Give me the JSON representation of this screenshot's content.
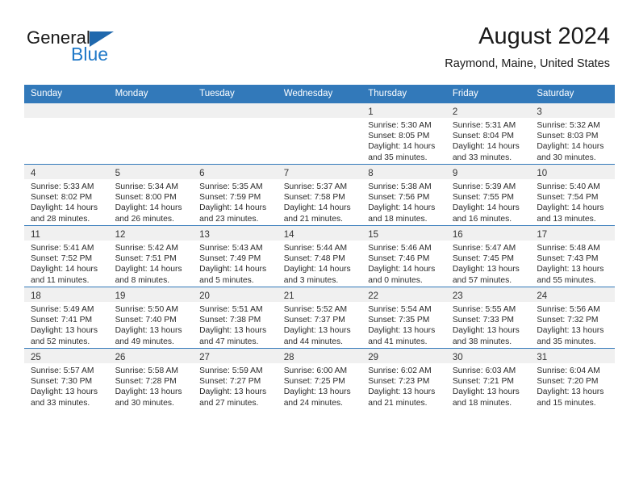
{
  "brand": {
    "line1": "General",
    "line2": "Blue",
    "flag_color": "#1f68ad",
    "text_color": "#2079c8"
  },
  "header": {
    "title": "August 2024",
    "location": "Raymond, Maine, United States"
  },
  "theme": {
    "header_bg": "#3279ba",
    "header_text": "#ffffff",
    "daynum_band_bg": "#f0f0f0",
    "cell_bg": "#ffffff",
    "grid_line": "#3279ba"
  },
  "weekday_headers": [
    "Sunday",
    "Monday",
    "Tuesday",
    "Wednesday",
    "Thursday",
    "Friday",
    "Saturday"
  ],
  "labels": {
    "sunrise": "Sunrise:",
    "sunset": "Sunset:",
    "daylight": "Daylight:"
  },
  "weeks": [
    [
      {
        "day": "",
        "empty": true
      },
      {
        "day": "",
        "empty": true
      },
      {
        "day": "",
        "empty": true
      },
      {
        "day": "",
        "empty": true
      },
      {
        "day": "1",
        "sunrise": "Sunrise: 5:30 AM",
        "sunset": "Sunset: 8:05 PM",
        "daylight1": "Daylight: 14 hours",
        "daylight2": "and 35 minutes."
      },
      {
        "day": "2",
        "sunrise": "Sunrise: 5:31 AM",
        "sunset": "Sunset: 8:04 PM",
        "daylight1": "Daylight: 14 hours",
        "daylight2": "and 33 minutes."
      },
      {
        "day": "3",
        "sunrise": "Sunrise: 5:32 AM",
        "sunset": "Sunset: 8:03 PM",
        "daylight1": "Daylight: 14 hours",
        "daylight2": "and 30 minutes."
      }
    ],
    [
      {
        "day": "4",
        "sunrise": "Sunrise: 5:33 AM",
        "sunset": "Sunset: 8:02 PM",
        "daylight1": "Daylight: 14 hours",
        "daylight2": "and 28 minutes."
      },
      {
        "day": "5",
        "sunrise": "Sunrise: 5:34 AM",
        "sunset": "Sunset: 8:00 PM",
        "daylight1": "Daylight: 14 hours",
        "daylight2": "and 26 minutes."
      },
      {
        "day": "6",
        "sunrise": "Sunrise: 5:35 AM",
        "sunset": "Sunset: 7:59 PM",
        "daylight1": "Daylight: 14 hours",
        "daylight2": "and 23 minutes."
      },
      {
        "day": "7",
        "sunrise": "Sunrise: 5:37 AM",
        "sunset": "Sunset: 7:58 PM",
        "daylight1": "Daylight: 14 hours",
        "daylight2": "and 21 minutes."
      },
      {
        "day": "8",
        "sunrise": "Sunrise: 5:38 AM",
        "sunset": "Sunset: 7:56 PM",
        "daylight1": "Daylight: 14 hours",
        "daylight2": "and 18 minutes."
      },
      {
        "day": "9",
        "sunrise": "Sunrise: 5:39 AM",
        "sunset": "Sunset: 7:55 PM",
        "daylight1": "Daylight: 14 hours",
        "daylight2": "and 16 minutes."
      },
      {
        "day": "10",
        "sunrise": "Sunrise: 5:40 AM",
        "sunset": "Sunset: 7:54 PM",
        "daylight1": "Daylight: 14 hours",
        "daylight2": "and 13 minutes."
      }
    ],
    [
      {
        "day": "11",
        "sunrise": "Sunrise: 5:41 AM",
        "sunset": "Sunset: 7:52 PM",
        "daylight1": "Daylight: 14 hours",
        "daylight2": "and 11 minutes."
      },
      {
        "day": "12",
        "sunrise": "Sunrise: 5:42 AM",
        "sunset": "Sunset: 7:51 PM",
        "daylight1": "Daylight: 14 hours",
        "daylight2": "and 8 minutes."
      },
      {
        "day": "13",
        "sunrise": "Sunrise: 5:43 AM",
        "sunset": "Sunset: 7:49 PM",
        "daylight1": "Daylight: 14 hours",
        "daylight2": "and 5 minutes."
      },
      {
        "day": "14",
        "sunrise": "Sunrise: 5:44 AM",
        "sunset": "Sunset: 7:48 PM",
        "daylight1": "Daylight: 14 hours",
        "daylight2": "and 3 minutes."
      },
      {
        "day": "15",
        "sunrise": "Sunrise: 5:46 AM",
        "sunset": "Sunset: 7:46 PM",
        "daylight1": "Daylight: 14 hours",
        "daylight2": "and 0 minutes."
      },
      {
        "day": "16",
        "sunrise": "Sunrise: 5:47 AM",
        "sunset": "Sunset: 7:45 PM",
        "daylight1": "Daylight: 13 hours",
        "daylight2": "and 57 minutes."
      },
      {
        "day": "17",
        "sunrise": "Sunrise: 5:48 AM",
        "sunset": "Sunset: 7:43 PM",
        "daylight1": "Daylight: 13 hours",
        "daylight2": "and 55 minutes."
      }
    ],
    [
      {
        "day": "18",
        "sunrise": "Sunrise: 5:49 AM",
        "sunset": "Sunset: 7:41 PM",
        "daylight1": "Daylight: 13 hours",
        "daylight2": "and 52 minutes."
      },
      {
        "day": "19",
        "sunrise": "Sunrise: 5:50 AM",
        "sunset": "Sunset: 7:40 PM",
        "daylight1": "Daylight: 13 hours",
        "daylight2": "and 49 minutes."
      },
      {
        "day": "20",
        "sunrise": "Sunrise: 5:51 AM",
        "sunset": "Sunset: 7:38 PM",
        "daylight1": "Daylight: 13 hours",
        "daylight2": "and 47 minutes."
      },
      {
        "day": "21",
        "sunrise": "Sunrise: 5:52 AM",
        "sunset": "Sunset: 7:37 PM",
        "daylight1": "Daylight: 13 hours",
        "daylight2": "and 44 minutes."
      },
      {
        "day": "22",
        "sunrise": "Sunrise: 5:54 AM",
        "sunset": "Sunset: 7:35 PM",
        "daylight1": "Daylight: 13 hours",
        "daylight2": "and 41 minutes."
      },
      {
        "day": "23",
        "sunrise": "Sunrise: 5:55 AM",
        "sunset": "Sunset: 7:33 PM",
        "daylight1": "Daylight: 13 hours",
        "daylight2": "and 38 minutes."
      },
      {
        "day": "24",
        "sunrise": "Sunrise: 5:56 AM",
        "sunset": "Sunset: 7:32 PM",
        "daylight1": "Daylight: 13 hours",
        "daylight2": "and 35 minutes."
      }
    ],
    [
      {
        "day": "25",
        "sunrise": "Sunrise: 5:57 AM",
        "sunset": "Sunset: 7:30 PM",
        "daylight1": "Daylight: 13 hours",
        "daylight2": "and 33 minutes."
      },
      {
        "day": "26",
        "sunrise": "Sunrise: 5:58 AM",
        "sunset": "Sunset: 7:28 PM",
        "daylight1": "Daylight: 13 hours",
        "daylight2": "and 30 minutes."
      },
      {
        "day": "27",
        "sunrise": "Sunrise: 5:59 AM",
        "sunset": "Sunset: 7:27 PM",
        "daylight1": "Daylight: 13 hours",
        "daylight2": "and 27 minutes."
      },
      {
        "day": "28",
        "sunrise": "Sunrise: 6:00 AM",
        "sunset": "Sunset: 7:25 PM",
        "daylight1": "Daylight: 13 hours",
        "daylight2": "and 24 minutes."
      },
      {
        "day": "29",
        "sunrise": "Sunrise: 6:02 AM",
        "sunset": "Sunset: 7:23 PM",
        "daylight1": "Daylight: 13 hours",
        "daylight2": "and 21 minutes."
      },
      {
        "day": "30",
        "sunrise": "Sunrise: 6:03 AM",
        "sunset": "Sunset: 7:21 PM",
        "daylight1": "Daylight: 13 hours",
        "daylight2": "and 18 minutes."
      },
      {
        "day": "31",
        "sunrise": "Sunrise: 6:04 AM",
        "sunset": "Sunset: 7:20 PM",
        "daylight1": "Daylight: 13 hours",
        "daylight2": "and 15 minutes."
      }
    ]
  ]
}
